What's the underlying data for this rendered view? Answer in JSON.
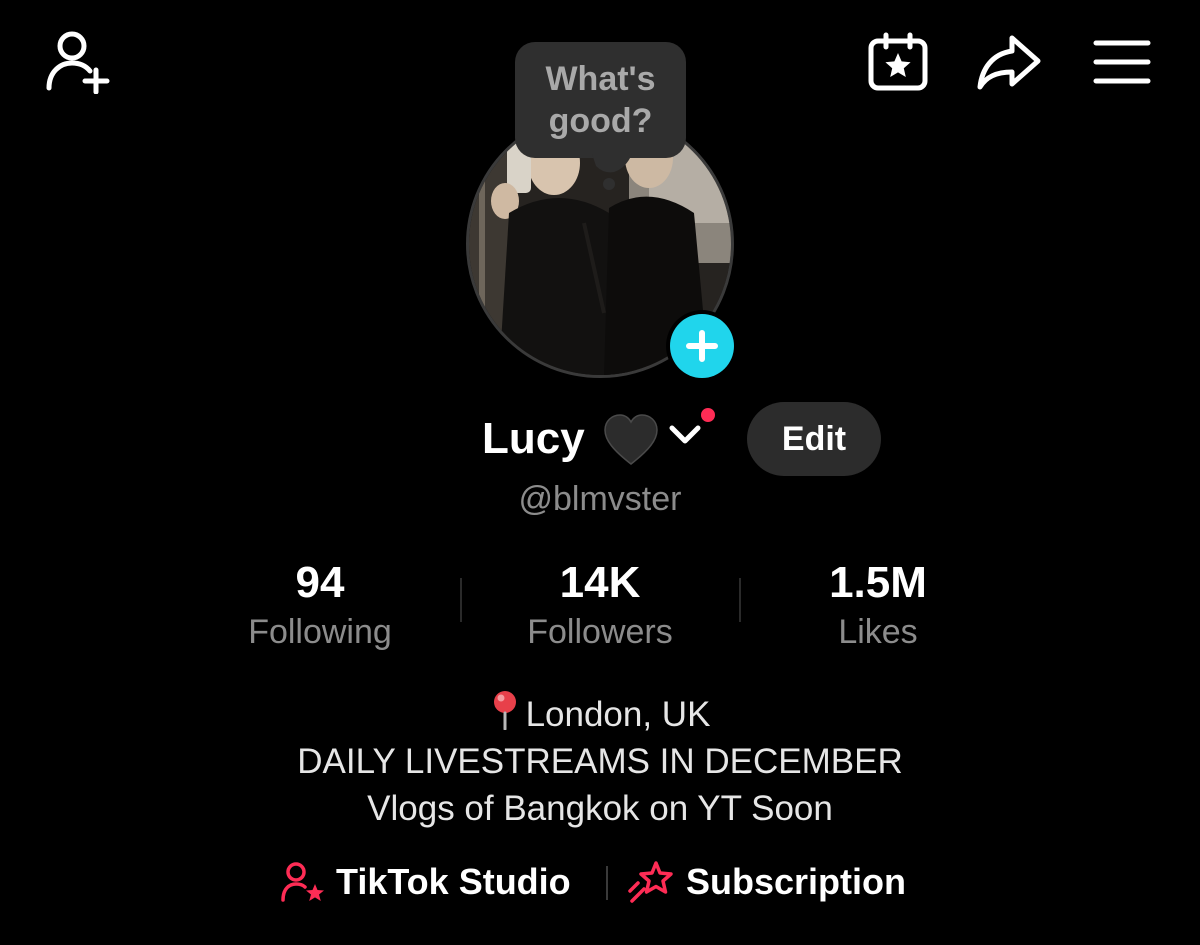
{
  "header": {
    "add_friend_icon": "person-plus-icon",
    "calendar_icon": "calendar-star-icon",
    "share_icon": "share-arrow-icon",
    "menu_icon": "hamburger-menu-icon"
  },
  "bubble": {
    "text_line1": "What's",
    "text_line2": "good?"
  },
  "profile": {
    "display_name": "Lucy",
    "name_emoji": "black-heart-icon",
    "username": "@blmvster",
    "edit_label": "Edit"
  },
  "stats": [
    {
      "value": "94",
      "label": "Following"
    },
    {
      "value": "14K",
      "label": "Followers"
    },
    {
      "value": "1.5M",
      "label": "Likes"
    }
  ],
  "bio": {
    "location": "London, UK",
    "line2": "DAILY LIVESTREAMS IN DECEMBER",
    "line3": "Vlogs of Bangkok on YT Soon"
  },
  "links": {
    "studio_label": "TikTok Studio",
    "subscription_label": "Subscription"
  },
  "colors": {
    "background": "#000000",
    "accent_cyan": "#20d5ec",
    "accent_red": "#fe2c55",
    "muted_text": "#8c8c8c"
  }
}
